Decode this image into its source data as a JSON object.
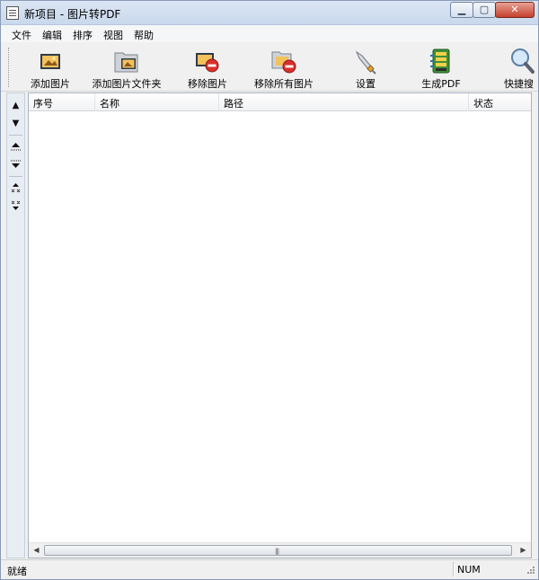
{
  "window": {
    "title": "新项目 - 图片转PDF"
  },
  "titlebar_buttons": {
    "minimize": "▁",
    "maximize": "▢",
    "close": "✕"
  },
  "menu": [
    "文件",
    "编辑",
    "排序",
    "视图",
    "帮助"
  ],
  "toolbar": [
    {
      "label": "添加图片",
      "icon": "add-image-icon"
    },
    {
      "label": "添加图片文件夹",
      "icon": "add-folder-icon"
    },
    {
      "label": "移除图片",
      "icon": "remove-image-icon"
    },
    {
      "label": "移除所有图片",
      "icon": "remove-all-images-icon"
    },
    {
      "label": "设置",
      "icon": "settings-icon"
    },
    {
      "label": "生成PDF",
      "icon": "create-pdf-icon"
    },
    {
      "label": "快捷搜",
      "icon": "search-icon"
    }
  ],
  "side_buttons": [
    "▲",
    "▼"
  ],
  "list": {
    "columns": [
      "序号",
      "名称",
      "路径",
      "状态"
    ],
    "rows": []
  },
  "scroll": {
    "left_arrow": "◀",
    "right_arrow": "▶",
    "grip": "|||"
  },
  "status": {
    "text": "就绪",
    "num": "NUM"
  },
  "colors": {
    "titlebar": "#c9d8ec",
    "close_button": "#c4402c",
    "list_bg": "#ffffff"
  }
}
